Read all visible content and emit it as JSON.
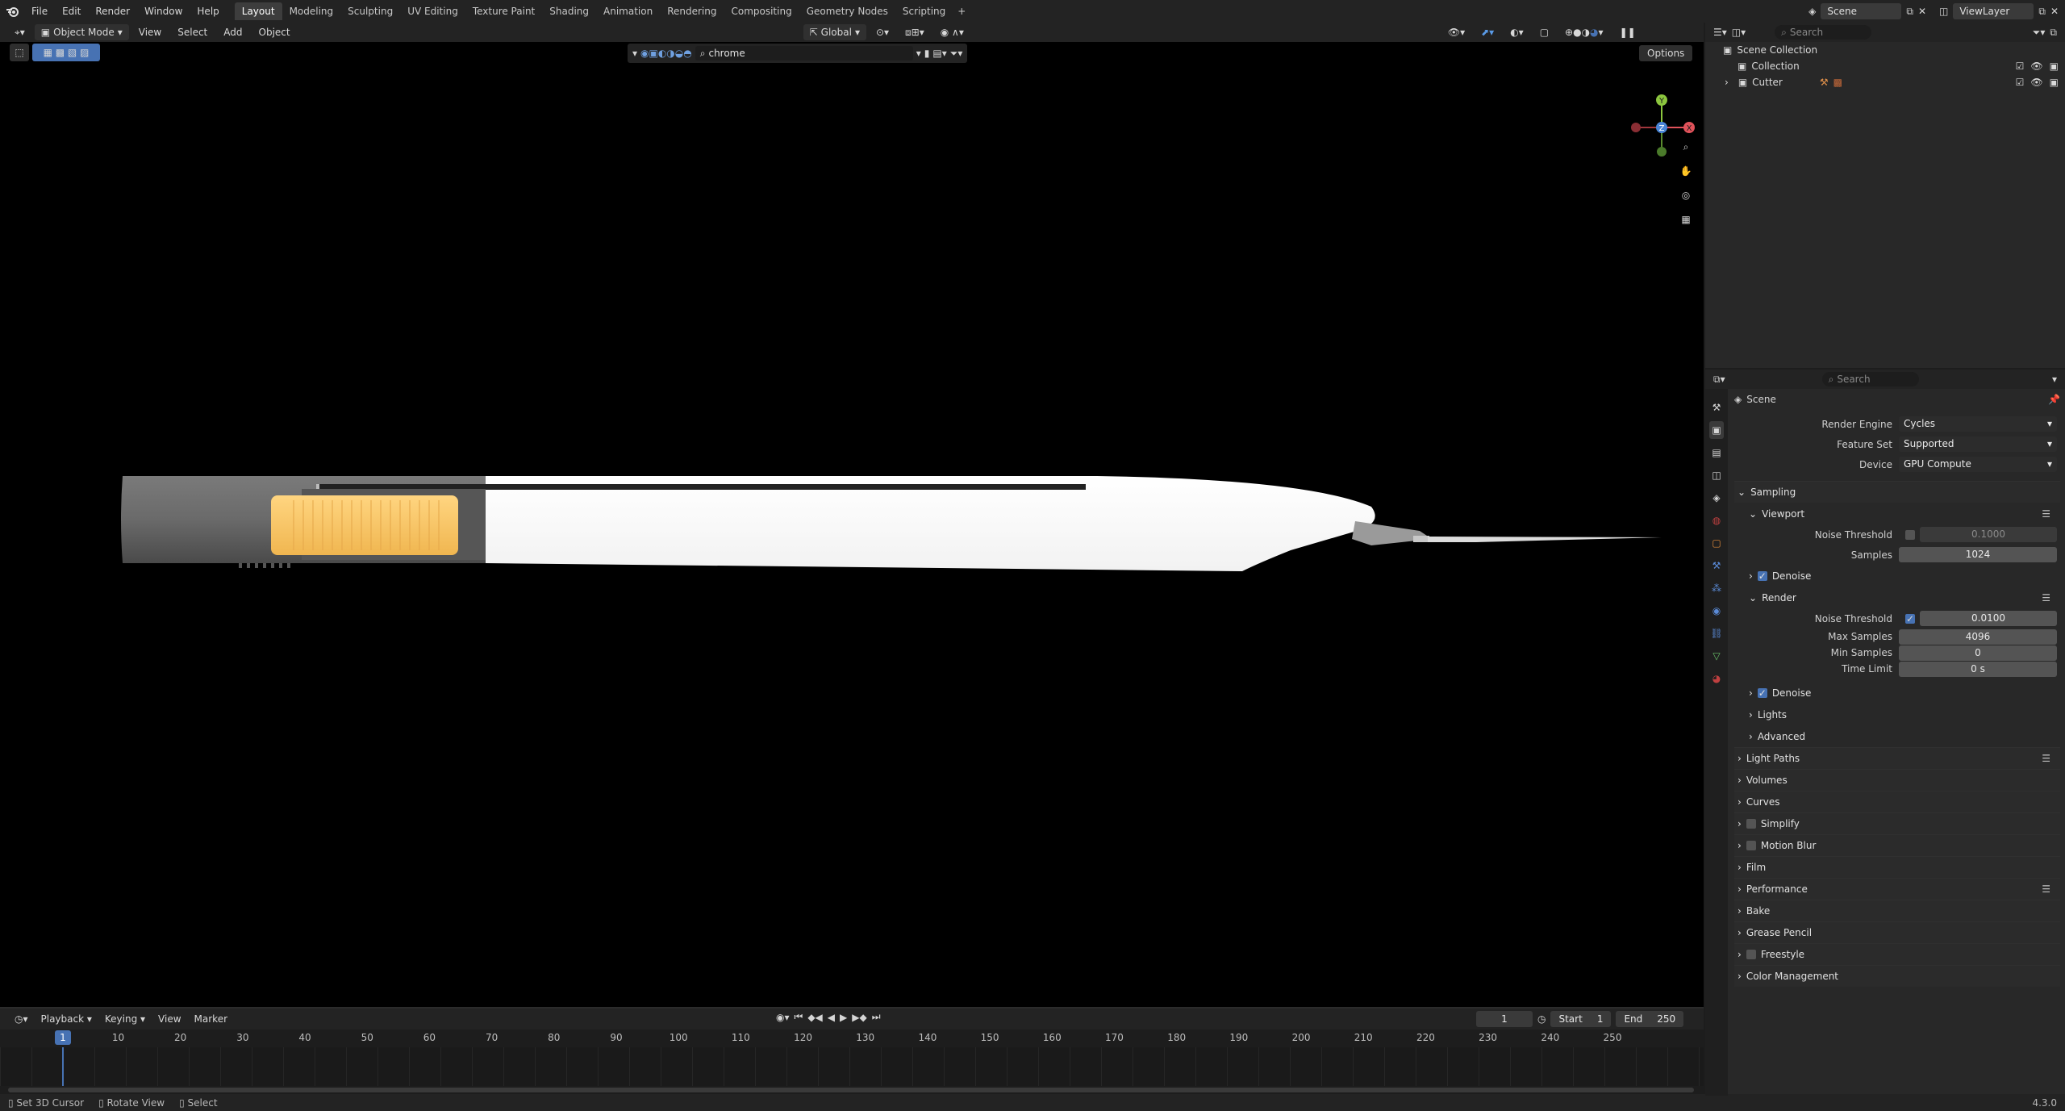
{
  "menubar": {
    "items": [
      "File",
      "Edit",
      "Render",
      "Window",
      "Help"
    ]
  },
  "workspaces": {
    "tabs": [
      "Layout",
      "Modeling",
      "Sculpting",
      "UV Editing",
      "Texture Paint",
      "Shading",
      "Animation",
      "Rendering",
      "Compositing",
      "Geometry Nodes",
      "Scripting"
    ],
    "active": "Layout",
    "add": "+"
  },
  "topright": {
    "scene": "Scene",
    "view_layer": "ViewLayer"
  },
  "viewport": {
    "mode": "Object Mode",
    "menus": [
      "View",
      "Select",
      "Add",
      "Object"
    ],
    "orientation": "Global",
    "filter_search": "chrome",
    "options": "Options",
    "gizmo": {
      "x": "X",
      "y": "Y",
      "z": "Z"
    }
  },
  "timeline": {
    "menus": [
      "Playback",
      "Keying",
      "View",
      "Marker"
    ],
    "current_frame": "1",
    "start_label": "Start",
    "start": "1",
    "end_label": "End",
    "end": "250",
    "ticks": [
      "10",
      "20",
      "30",
      "40",
      "50",
      "60",
      "70",
      "80",
      "90",
      "100",
      "110",
      "120",
      "130",
      "140",
      "150",
      "160",
      "170",
      "180",
      "190",
      "200",
      "210",
      "220",
      "230",
      "240",
      "250"
    ]
  },
  "status": {
    "items": [
      "Set 3D Cursor",
      "Rotate View",
      "Select"
    ],
    "version": "4.3.0"
  },
  "outliner": {
    "search_placeholder": "Search",
    "rows": [
      "Scene Collection",
      "Collection",
      "Cutter"
    ]
  },
  "properties": {
    "search_placeholder": "Search",
    "context": "Scene",
    "render_engine_label": "Render Engine",
    "render_engine": "Cycles",
    "feature_set_label": "Feature Set",
    "feature_set": "Supported",
    "device_label": "Device",
    "device": "GPU Compute",
    "sampling": "Sampling",
    "viewport": "Viewport",
    "vp_noise_label": "Noise Threshold",
    "vp_noise": "0.1000",
    "vp_samples_label": "Samples",
    "vp_samples": "1024",
    "denoise": "Denoise",
    "render": "Render",
    "r_noise_label": "Noise Threshold",
    "r_noise": "0.0100",
    "max_samples_label": "Max Samples",
    "max_samples": "4096",
    "min_samples_label": "Min Samples",
    "min_samples": "0",
    "time_limit_label": "Time Limit",
    "time_limit": "0 s",
    "denoise2": "Denoise",
    "lights": "Lights",
    "advanced": "Advanced",
    "panels": [
      "Light Paths",
      "Volumes",
      "Curves",
      "Simplify",
      "Motion Blur",
      "Film",
      "Performance",
      "Bake",
      "Grease Pencil",
      "Freestyle",
      "Color Management"
    ]
  },
  "colors": {
    "accent": "#4772b3",
    "handle": "#f7c25e",
    "background": "#000000"
  }
}
